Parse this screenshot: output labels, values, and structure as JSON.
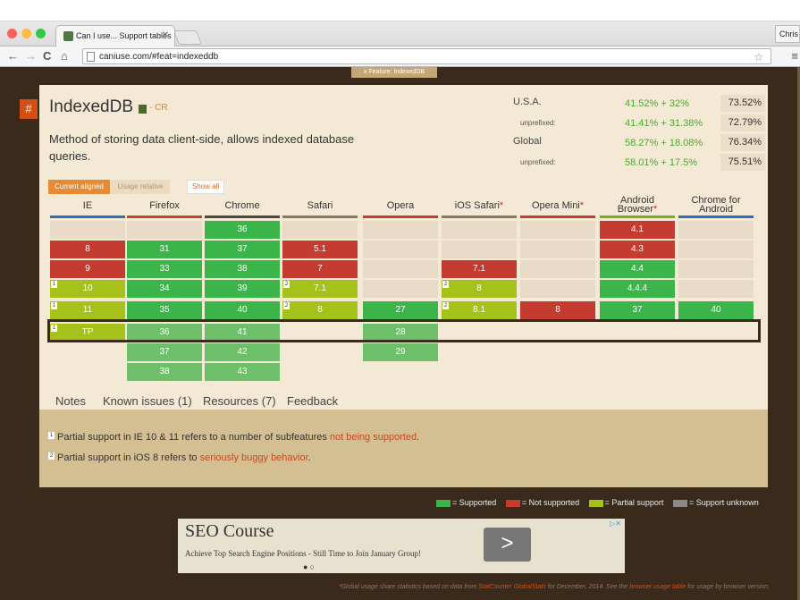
{
  "browser": {
    "tab_title": "Can I use... Support tables",
    "url": "caniuse.com/#feat=indexeddb",
    "profile": "Chris"
  },
  "feature_tab": "Feature: IndexedDB",
  "feature": {
    "hash": "#",
    "name": "IndexedDB",
    "status": "- CR",
    "description": "Method of storing data client-side, allows indexed database queries."
  },
  "usage": {
    "usa_label": "U.S.A.",
    "usa_eq": "41.52% + 32%",
    "usa_total": "73.52%",
    "usa_unpref_label": "unprefixed:",
    "usa_unpref_eq": "41.41% + 31.38%",
    "usa_unpref_total": "72.79%",
    "global_label": "Global",
    "global_eq": "58.27% + 18.08%",
    "global_total": "76.34%",
    "global_unpref_label": "unprefixed:",
    "global_unpref_eq": "58.01% + 17.5%",
    "global_unpref_total": "75.51%",
    "equals": "="
  },
  "controls": {
    "current_aligned": "Current aligned",
    "usage_relative": "Usage relative",
    "show_all": "Show all"
  },
  "browsers": [
    {
      "name": "IE",
      "line": "#2a6fb8",
      "star": false,
      "cells": [
        {
          "v": "",
          "s": "e"
        },
        {
          "v": "8",
          "s": "r"
        },
        {
          "v": "9",
          "s": "r"
        },
        {
          "v": "10",
          "s": "y",
          "n": "1"
        },
        {
          "v": "11",
          "s": "y",
          "n": "1"
        },
        {
          "v": "TP",
          "s": "y",
          "n": "1"
        }
      ]
    },
    {
      "name": "Firefox",
      "line": "#c4491f",
      "cells": [
        {
          "v": "",
          "s": "e"
        },
        {
          "v": "31",
          "s": "g"
        },
        {
          "v": "33",
          "s": "g"
        },
        {
          "v": "34",
          "s": "g"
        },
        {
          "v": "35",
          "s": "g"
        },
        {
          "v": "36",
          "s": "gl"
        },
        {
          "v": "37",
          "s": "gl"
        },
        {
          "v": "38",
          "s": "gl"
        }
      ]
    },
    {
      "name": "Chrome",
      "line": "#4a4a4a",
      "cells": [
        {
          "v": "36",
          "s": "g"
        },
        {
          "v": "37",
          "s": "g"
        },
        {
          "v": "38",
          "s": "g"
        },
        {
          "v": "39",
          "s": "g"
        },
        {
          "v": "40",
          "s": "g"
        },
        {
          "v": "41",
          "s": "gl"
        },
        {
          "v": "42",
          "s": "gl"
        },
        {
          "v": "43",
          "s": "gl"
        }
      ]
    },
    {
      "name": "Safari",
      "line": "#8a7a5c",
      "cells": [
        {
          "v": "",
          "s": "e"
        },
        {
          "v": "5.1",
          "s": "r"
        },
        {
          "v": "7",
          "s": "r"
        },
        {
          "v": "7.1",
          "s": "y",
          "n": "2"
        },
        {
          "v": "8",
          "s": "y",
          "n": "2"
        }
      ]
    },
    {
      "name": "Opera",
      "line": "#c43b2f",
      "cells": [
        {
          "v": "",
          "s": "e"
        },
        {
          "v": "",
          "s": "e"
        },
        {
          "v": "",
          "s": "e"
        },
        {
          "v": "",
          "s": "e"
        },
        {
          "v": "27",
          "s": "g"
        },
        {
          "v": "28",
          "s": "gl"
        },
        {
          "v": "29",
          "s": "gl"
        }
      ]
    },
    {
      "name": "iOS Safari",
      "line": "#8a7a5c",
      "star": true,
      "cells": [
        {
          "v": "",
          "s": "e"
        },
        {
          "v": "",
          "s": "e"
        },
        {
          "v": "7.1",
          "s": "r"
        },
        {
          "v": "8",
          "s": "y",
          "n": "2"
        },
        {
          "v": "8.1",
          "s": "y",
          "n": "2"
        }
      ]
    },
    {
      "name": "Opera Mini",
      "line": "#c43b2f",
      "star": true,
      "cells": [
        {
          "v": "",
          "s": "e"
        },
        {
          "v": "",
          "s": "e"
        },
        {
          "v": "",
          "s": "e"
        },
        {
          "v": "",
          "s": "e"
        },
        {
          "v": "8",
          "s": "r"
        }
      ]
    },
    {
      "name": "Android Browser",
      "line": "#7cae1e",
      "star": true,
      "cells": [
        {
          "v": "4.1",
          "s": "r"
        },
        {
          "v": "4.3",
          "s": "r"
        },
        {
          "v": "4.4",
          "s": "g"
        },
        {
          "v": "4.4.4",
          "s": "g"
        },
        {
          "v": "37",
          "s": "g"
        }
      ]
    },
    {
      "name": "Chrome for Android",
      "line": "#2a6fb8",
      "cells": [
        {
          "v": "",
          "s": "e"
        },
        {
          "v": "",
          "s": "e"
        },
        {
          "v": "",
          "s": "e"
        },
        {
          "v": "",
          "s": "e"
        },
        {
          "v": "40",
          "s": "g"
        }
      ]
    }
  ],
  "browser_names": {
    "ie": "IE",
    "firefox": "Firefox",
    "chrome": "Chrome",
    "safari": "Safari",
    "opera": "Opera",
    "ios_safari": "iOS Safari",
    "opera_mini": "Opera Mini",
    "android_1": "Android",
    "android_2": "Browser",
    "cfa_1": "Chrome for",
    "cfa_2": "Android",
    "star": "*"
  },
  "tabs": {
    "notes": "Notes",
    "known_issues": "Known issues (1)",
    "resources": "Resources (7)",
    "feedback": "Feedback"
  },
  "notes": {
    "n1_sup": "1",
    "n1_text": "Partial support in IE 10 & 11 refers to a number of subfeatures ",
    "n1_link": "not being supported",
    "n1_end": ".",
    "n2_sup": "2",
    "n2_text": "Partial support in iOS 8 refers to ",
    "n2_link": "seriously buggy behavior",
    "n2_end": "."
  },
  "legend": {
    "supported": "= Supported",
    "not_supported": "= Not supported",
    "partial": "= Partial support",
    "unknown": "= Support unknown",
    "colors": {
      "supported": "#3bb54a",
      "not_supported": "#c43b2f",
      "partial": "#a6c11a",
      "unknown": "#8a8a8a"
    }
  },
  "ad": {
    "title": "SEO Course",
    "text": "Achieve Top Search Engine Positions - Still Time to Join January Group!",
    "arrow": ">",
    "choices": "▷✕",
    "dots": "●○"
  },
  "footer": {
    "t1": "*Global usage share statistics based on data from ",
    "l1": "StatCounter GlobalStats",
    "t2": " for December, 2014. See the ",
    "l2": "browser usage table",
    "t3": " for usage by browser version."
  }
}
